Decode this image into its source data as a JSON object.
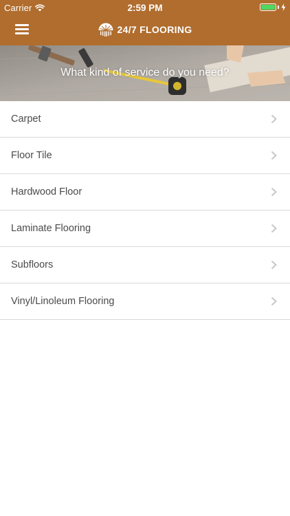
{
  "status_bar": {
    "carrier": "Carrier",
    "time": "2:59 PM",
    "battery_level": 1.0,
    "wifi_icon": "wifi-icon",
    "charging_icon": "charging-bolt-icon"
  },
  "header": {
    "brand_name": "24/7 FLOORING",
    "menu_icon": "hamburger-menu-icon",
    "logo_icon": "sunrise-logo-icon",
    "background_color": "#b06d2e"
  },
  "hero": {
    "prompt": "What kind of service do you need?"
  },
  "services": [
    {
      "label": "Carpet"
    },
    {
      "label": "Floor Tile"
    },
    {
      "label": "Hardwood Floor"
    },
    {
      "label": "Laminate Flooring"
    },
    {
      "label": "Subfloors"
    },
    {
      "label": "Vinyl/Linoleum Flooring"
    }
  ],
  "colors": {
    "accent": "#b06d2e",
    "battery": "#4cd964",
    "list_text": "#4a4a4a",
    "divider": "#d9d9d9"
  }
}
